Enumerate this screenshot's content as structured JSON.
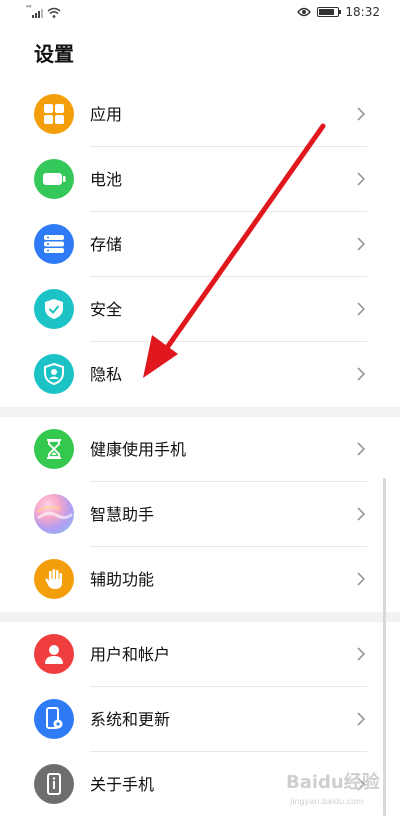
{
  "status_bar": {
    "signal_label": "⁴⁶",
    "time": "18:32",
    "battery_level": 0.85
  },
  "page": {
    "title": "设置"
  },
  "groups": [
    {
      "items": [
        {
          "label": "应用",
          "icon": "apps-grid-icon",
          "color": "#F59E0B"
        },
        {
          "label": "电池",
          "icon": "battery-icon",
          "color": "#34C759"
        },
        {
          "label": "存储",
          "icon": "storage-icon",
          "color": "#2F7BF6"
        },
        {
          "label": "安全",
          "icon": "shield-check-icon",
          "color": "#1BC3C6"
        },
        {
          "label": "隐私",
          "icon": "privacy-shield-icon",
          "color": "#1BC3C6"
        }
      ]
    },
    {
      "items": [
        {
          "label": "健康使用手机",
          "icon": "hourglass-icon",
          "color": "#35C84E"
        },
        {
          "label": "智慧助手",
          "icon": "assistant-orb-icon",
          "color": "#B9A0F5"
        },
        {
          "label": "辅助功能",
          "icon": "hand-icon",
          "color": "#F59E0B"
        }
      ]
    },
    {
      "items": [
        {
          "label": "用户和帐户",
          "icon": "user-icon",
          "color": "#F03E3E"
        },
        {
          "label": "系统和更新",
          "icon": "phone-settings-icon",
          "color": "#2F7BF6"
        },
        {
          "label": "关于手机",
          "icon": "phone-info-icon",
          "color": "#6E6E6E"
        }
      ]
    }
  ],
  "watermark": {
    "text": "Baidu经验",
    "subtext": "jingyan.baidu.com"
  }
}
